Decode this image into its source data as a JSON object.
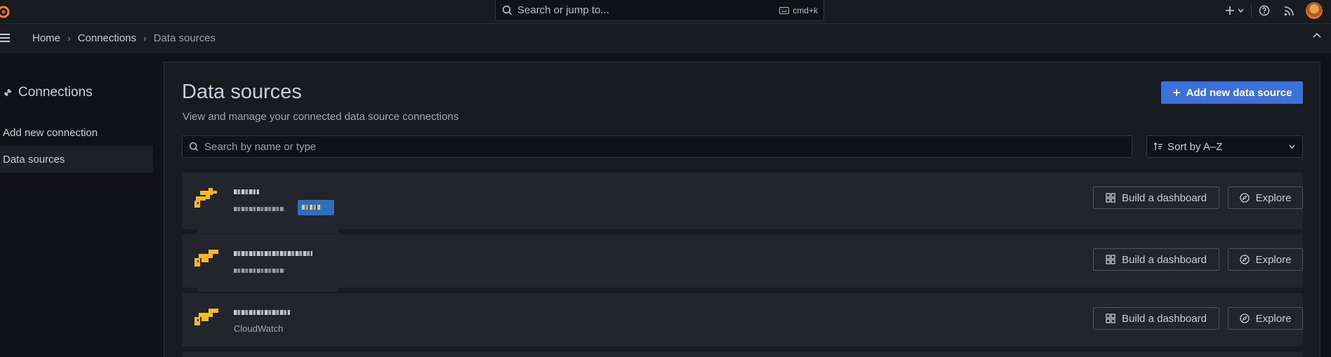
{
  "topbar": {
    "search_placeholder": "Search or jump to...",
    "shortcut": "cmd+k",
    "icons": [
      "grafana-logo-icon",
      "search-icon",
      "keyboard-icon",
      "plus-icon",
      "help-icon",
      "rss-icon",
      "avatar"
    ]
  },
  "breadcrumb": {
    "items": [
      "Home",
      "Connections",
      "Data sources"
    ]
  },
  "sidebar": {
    "title": "Connections",
    "items": [
      {
        "label": "Add new connection",
        "active": false
      },
      {
        "label": "Data sources",
        "active": true
      }
    ]
  },
  "main": {
    "title": "Data sources",
    "subtitle": "View and manage your connected data source connections",
    "add_button": "Add new data source",
    "search_placeholder": "Search by name or type",
    "sort_label": "Sort by A–Z"
  },
  "datasources": [
    {
      "name": "",
      "type": "",
      "has_badge": true,
      "build_label": "Build a dashboard",
      "explore_label": "Explore"
    },
    {
      "name": "",
      "type": "",
      "has_badge": false,
      "build_label": "Build a dashboard",
      "explore_label": "Explore"
    },
    {
      "name": "",
      "type": "CloudWatch",
      "has_badge": false,
      "build_label": "Build a dashboard",
      "explore_label": "Explore"
    }
  ],
  "colors": {
    "accent": "#3d71d9",
    "badge": "#2c6fbf",
    "datasource_icon": "#f5b928",
    "background": "#111217",
    "panel": "#181b1f",
    "card": "#22252b"
  }
}
